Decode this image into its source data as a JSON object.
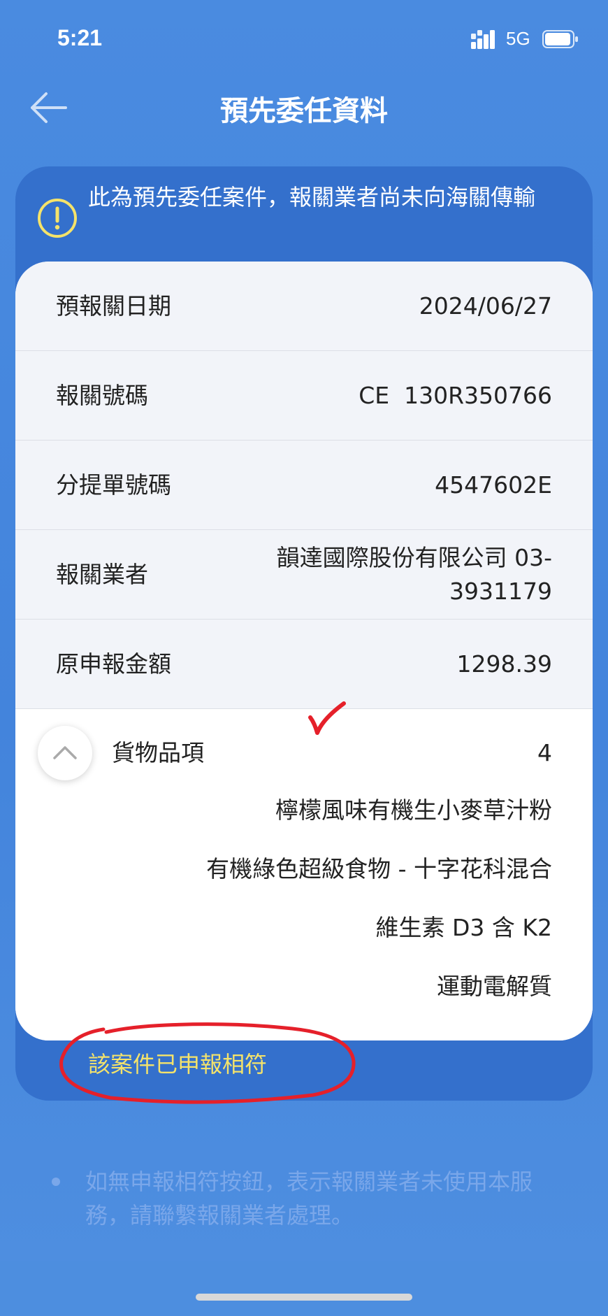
{
  "status_bar": {
    "time": "5:21",
    "network": "5G"
  },
  "header": {
    "title": "預先委任資料"
  },
  "notice": {
    "text": "此為預先委任案件，報關業者尚未向海關傳輸"
  },
  "details": {
    "rows": [
      {
        "label": "預報關日期",
        "value": "2024/06/27"
      },
      {
        "label": "報關號碼",
        "value": "CE  130R350766"
      },
      {
        "label": "分提單號碼",
        "value": "4547602E"
      },
      {
        "label": "報關業者",
        "value": "韻達國際股份有限公司 03-3931179"
      },
      {
        "label": "原申報金額",
        "value": "1298.39"
      }
    ]
  },
  "goods": {
    "label": "貨物品項",
    "count": "4",
    "items": [
      "檸檬風味有機生小麥草汁粉",
      "有機綠色超級食物 - 十字花科混合",
      "維生素 D3 含 K2",
      "運動電解質"
    ]
  },
  "match_status": "該案件已申報相符",
  "footnote": "如無申報相符按鈕，表示報關業者未使用本服務，請聯繫報關業者處理。",
  "colors": {
    "background": "#4a8be0",
    "card": "#3470cc",
    "match_text": "#f5e36a",
    "annotation": "#e5202a"
  }
}
